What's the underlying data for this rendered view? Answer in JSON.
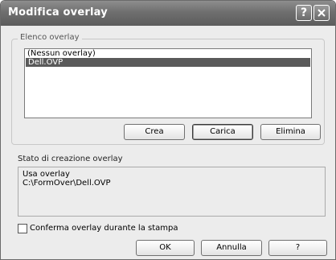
{
  "window": {
    "title": "Modifica overlay",
    "help_label": "?"
  },
  "overlay_list": {
    "legend": "Elenco overlay",
    "items": [
      "(Nessun overlay)",
      "Dell.OVP"
    ],
    "selected": "Dell.OVP"
  },
  "list_buttons": {
    "create": "Crea",
    "load": "Carica",
    "delete": "Elimina"
  },
  "status": {
    "label": "Stato di creazione overlay",
    "line1": "Usa overlay",
    "line2": "C:\\FormOver\\Dell.OVP"
  },
  "confirm": {
    "label": "Conferma overlay durante la stampa",
    "checked": false
  },
  "footer": {
    "ok": "OK",
    "cancel": "Annulla",
    "help": "?"
  }
}
